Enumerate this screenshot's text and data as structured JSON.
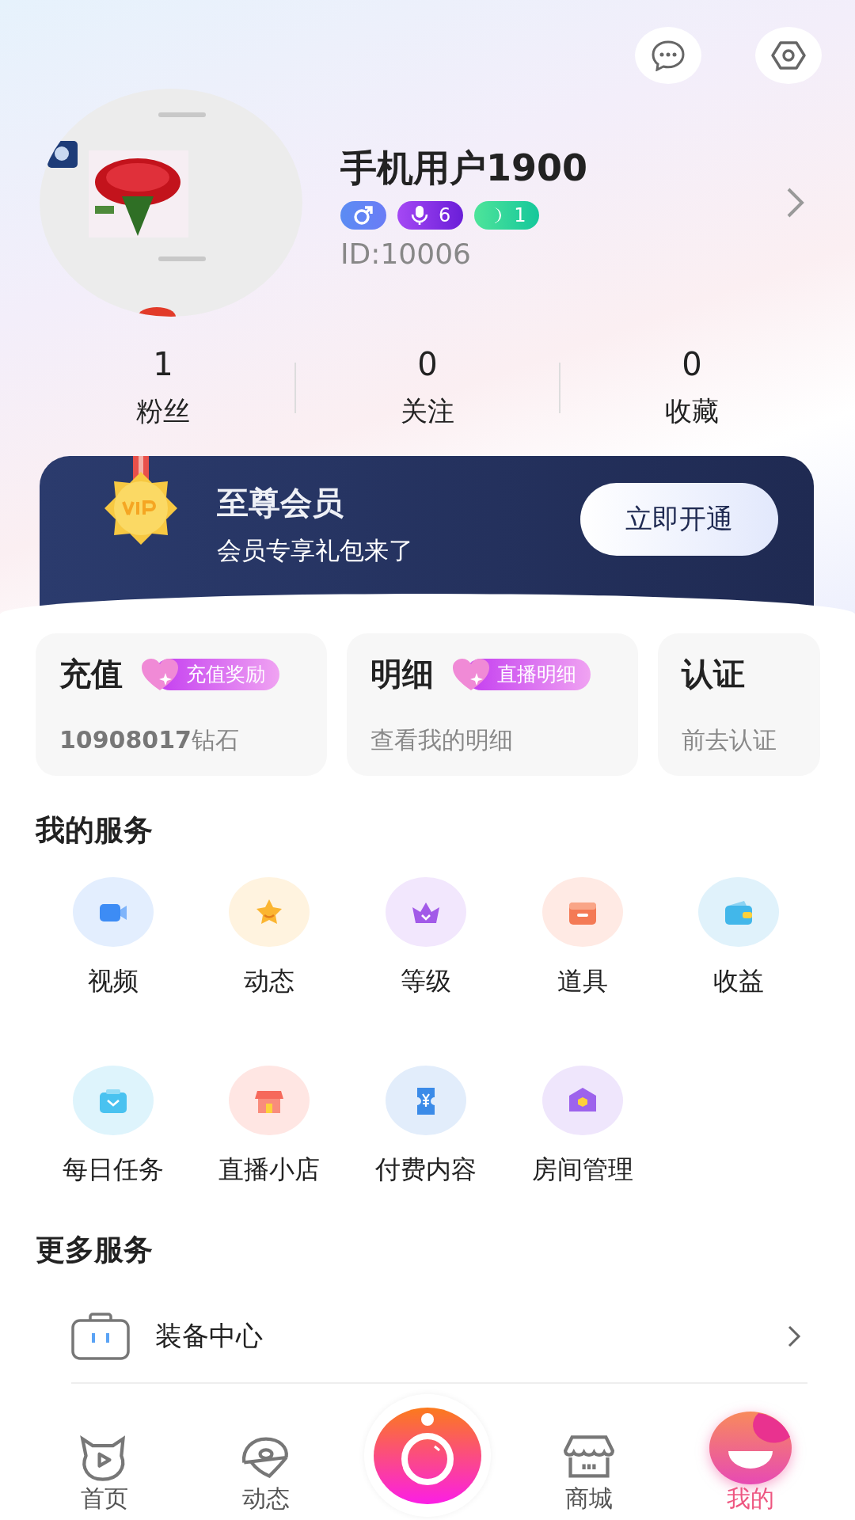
{
  "header": {
    "name": "手机用户1900",
    "id_text": "ID:10006",
    "badges": [
      {
        "kind": "gender"
      },
      {
        "kind": "voice",
        "text": "6"
      },
      {
        "kind": "moon",
        "text": "1"
      }
    ]
  },
  "stats": [
    {
      "value": "1",
      "label": "粉丝"
    },
    {
      "value": "0",
      "label": "关注"
    },
    {
      "value": "0",
      "label": "收藏"
    }
  ],
  "vip": {
    "title": "至尊会员",
    "subtitle": "会员专享礼包来了",
    "button": "立即开通"
  },
  "cards": [
    {
      "title": "充值",
      "tag": "充值奖励",
      "detail": "**10908017**钻石"
    },
    {
      "title": "明细",
      "tag": "直播明细",
      "detail": "查看我的明细"
    },
    {
      "title": "认证",
      "detail": "前去认证"
    }
  ],
  "my_services": {
    "title": "我的服务",
    "items": [
      {
        "kind": "video",
        "label": "视频"
      },
      {
        "kind": "star",
        "label": "动态"
      },
      {
        "kind": "crown",
        "label": "等级"
      },
      {
        "kind": "box",
        "label": "道具"
      },
      {
        "kind": "wallet",
        "label": "收益"
      },
      {
        "kind": "bag",
        "label": "每日任务"
      },
      {
        "kind": "shop",
        "label": "直播小店"
      },
      {
        "kind": "ticket",
        "label": "付费内容"
      },
      {
        "kind": "house",
        "label": "房间管理"
      }
    ]
  },
  "more_services": {
    "title": "更多服务",
    "items": [
      {
        "label": "装备中心"
      }
    ]
  },
  "bottom_nav": [
    {
      "kind": "home",
      "label": "首页",
      "selected": false
    },
    {
      "kind": "planet",
      "label": "动态",
      "selected": false
    },
    {
      "kind": "camera",
      "selected": false
    },
    {
      "kind": "store",
      "label": "商城",
      "selected": false
    },
    {
      "kind": "me",
      "label": "我的",
      "selected": true
    }
  ]
}
